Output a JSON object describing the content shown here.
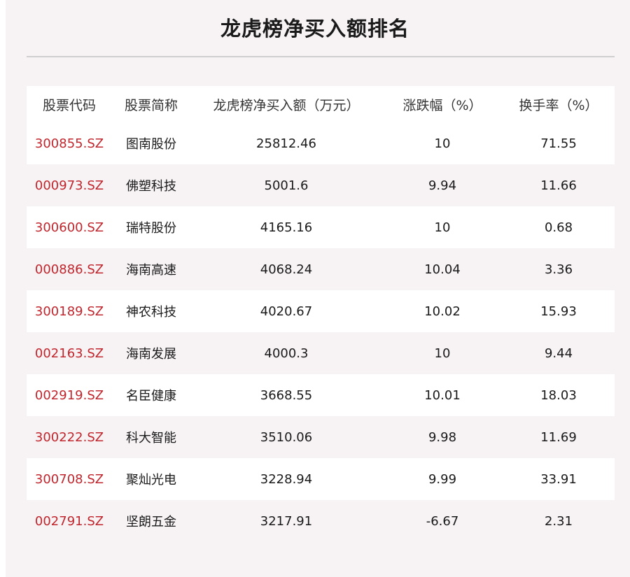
{
  "title": "龙虎榜净买入额排名",
  "colors": {
    "code": "#c0262d",
    "panel": "#f7f3f4"
  },
  "headers": [
    "股票代码",
    "股票简称",
    "龙虎榜净买入额（万元）",
    "涨跌幅（%）",
    "换手率（%）"
  ],
  "rows": [
    [
      "300855.SZ",
      "图南股份",
      "25812.46",
      "10",
      "71.55"
    ],
    [
      "000973.SZ",
      "佛塑科技",
      "5001.6",
      "9.94",
      "11.66"
    ],
    [
      "300600.SZ",
      "瑞特股份",
      "4165.16",
      "10",
      "0.68"
    ],
    [
      "000886.SZ",
      "海南高速",
      "4068.24",
      "10.04",
      "3.36"
    ],
    [
      "300189.SZ",
      "神农科技",
      "4020.67",
      "10.02",
      "15.93"
    ],
    [
      "002163.SZ",
      "海南发展",
      "4000.3",
      "10",
      "9.44"
    ],
    [
      "002919.SZ",
      "名臣健康",
      "3668.55",
      "10.01",
      "18.03"
    ],
    [
      "300222.SZ",
      "科大智能",
      "3510.06",
      "9.98",
      "11.69"
    ],
    [
      "300708.SZ",
      "聚灿光电",
      "3228.94",
      "9.99",
      "33.91"
    ],
    [
      "002791.SZ",
      "坚朗五金",
      "3217.91",
      "-6.67",
      "2.31"
    ]
  ]
}
